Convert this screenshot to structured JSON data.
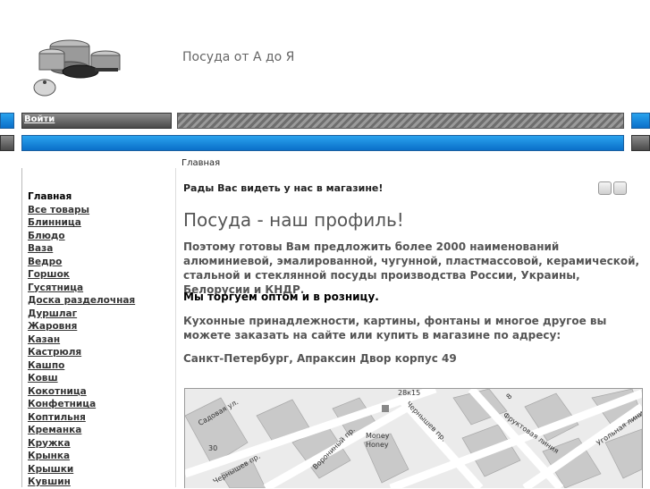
{
  "header": {
    "site_title": "Посуда от А до Я"
  },
  "nav": {
    "login_label": "Войти"
  },
  "sidebar": {
    "items": [
      {
        "label": "Главная"
      },
      {
        "label": "Все товары"
      },
      {
        "label": "Блинница"
      },
      {
        "label": "Блюдо"
      },
      {
        "label": "Ваза"
      },
      {
        "label": "Ведро"
      },
      {
        "label": "Горшок"
      },
      {
        "label": "Гусятница"
      },
      {
        "label": "Доска разделочная"
      },
      {
        "label": "Дуршлаг"
      },
      {
        "label": "Жаровня"
      },
      {
        "label": "Казан"
      },
      {
        "label": "Кастрюля"
      },
      {
        "label": "Кашпо"
      },
      {
        "label": "Ковш"
      },
      {
        "label": "Кокотница"
      },
      {
        "label": "Конфетница"
      },
      {
        "label": "Коптильня"
      },
      {
        "label": "Креманка"
      },
      {
        "label": "Кружка"
      },
      {
        "label": "Крынка"
      },
      {
        "label": "Крышки"
      },
      {
        "label": "Кувшин"
      }
    ]
  },
  "main": {
    "breadcrumb": "Главная",
    "welcome": "Рады Вас видеть у нас в магазине!",
    "heading": "Посуда - наш профиль!",
    "para1": "Поэтому готовы Вам предложить более 2000 наименований алюминиевой, эмалированной, чугунной, пластмассовой, керамической, стальной и стеклянной посуды производства России, Украины, Белорусии и КНДР.",
    "para2": "Мы торгуем оптом и в розницу.",
    "para3": "Кухонные принадлежности, картины, фонтаны и многое другое вы можете заказать на сайте или купить в магазине по адресу:",
    "address": "Санкт-Петербург, Апраксин Двор корпус 49"
  },
  "map": {
    "labels": {
      "sadovaya": "Садовая ул.",
      "chernyshev1": "Чернышев пр.",
      "chernyshev2": "Чернышев пр.",
      "voronikhin": "Ворониный пр.",
      "money": "Money",
      "honey": "Honey",
      "fruktovaya": "Фруктовая линия",
      "ugolnaya": "Угольная линия",
      "num30": "30",
      "num28k15": "28к15",
      "num8": "8"
    }
  },
  "colors": {
    "accent_blue": "#0a6fc9",
    "bar_grey": "#4a4a4a"
  },
  "icons": [
    "print-icon",
    "email-icon"
  ]
}
